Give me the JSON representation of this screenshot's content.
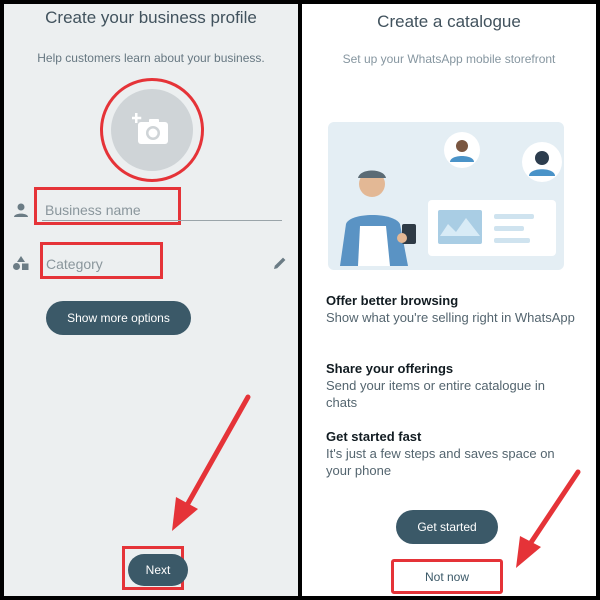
{
  "left_screen": {
    "title": "Create your business profile",
    "subtitle": "Help customers learn about your business.",
    "profile_photo": {
      "icon": "add-photo-camera-icon"
    },
    "business_name_field": {
      "placeholder": "Business name",
      "icon": "person-icon"
    },
    "category_field": {
      "placeholder": "Category",
      "icon": "shapes-icon",
      "edit_icon": "pencil-icon"
    },
    "show_more_button": "Show more options",
    "next_button": "Next"
  },
  "right_screen": {
    "title": "Create a catalogue",
    "subtitle": "Set up your WhatsApp mobile storefront",
    "illustration": "storefront-illustration",
    "features": [
      {
        "title": "Offer better browsing",
        "description": "Show what you're selling right in WhatsApp"
      },
      {
        "title": "Share your offerings",
        "description": "Send your items or entire catalogue in chats"
      },
      {
        "title": "Get started fast",
        "description": "It's just a few steps and saves space on your phone"
      }
    ],
    "get_started_button": "Get started",
    "not_now_button": "Not now"
  },
  "colors": {
    "highlight_red": "#e53338",
    "button_teal": "#3b5968",
    "left_background": "#eceff0",
    "right_background": "#ffffff"
  }
}
